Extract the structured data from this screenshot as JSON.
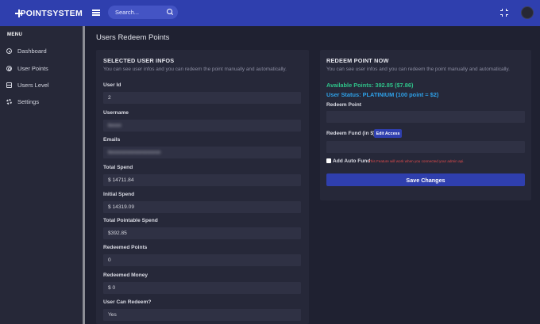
{
  "topbar": {
    "brand": "POINTSYSTEM",
    "search_placeholder": "Search..."
  },
  "sidebar": {
    "menu_title": "MENU",
    "items": [
      {
        "label": "Dashboard",
        "icon": "dashboard-icon"
      },
      {
        "label": "User Points",
        "icon": "points-icon"
      },
      {
        "label": "Users Level",
        "icon": "level-icon"
      },
      {
        "label": "Settings",
        "icon": "settings-icon"
      }
    ]
  },
  "page": {
    "title": "Users Redeem Points"
  },
  "selected_user": {
    "heading": "SELECTED USER INFOS",
    "subtitle": "You can see user infos and you can redeem the point manually and automatically.",
    "fields": [
      {
        "label": "User Id",
        "value": "2"
      },
      {
        "label": "Username",
        "value": "bxxxx"
      },
      {
        "label": "Emails",
        "value": "bxxxxxxxxxxxxxxxxxxx"
      },
      {
        "label": "Total Spend",
        "value": "$ 14711.84"
      },
      {
        "label": "Initial Spend",
        "value": "$ 14319.09"
      },
      {
        "label": "Total Pointable Spend",
        "value": "$392.85"
      },
      {
        "label": "Redeemed Points",
        "value": "0"
      },
      {
        "label": "Redeemed Money",
        "value": "$ 0"
      },
      {
        "label": "User Can Redeem?",
        "value": "Yes"
      }
    ]
  },
  "redeem": {
    "heading": "REDEEM POINT NOW",
    "subtitle": "You can see user infos and you can redeem the point manually and automatically.",
    "available": "Available Points: 392.85 ($7.86)",
    "status": "User Status: PLATINIUM (100 point = $2)",
    "redeem_point_label": "Redeem Point",
    "redeem_point_value": "",
    "redeem_fund_label": "Redeem Fund (in $)",
    "edit_access": "Edit Access",
    "redeem_fund_value": "",
    "auto_fund_label": "Add Auto Fund",
    "auto_fund_note": "This Feature will work when you connected your admin api.",
    "save": "Save Changes"
  },
  "colors": {
    "topbar": "#2f3fae",
    "background": "#1f2131",
    "card": "#262839",
    "available_green": "#2fc38a",
    "status_blue": "#2ea1e9",
    "note_red": "#e14b4b"
  }
}
